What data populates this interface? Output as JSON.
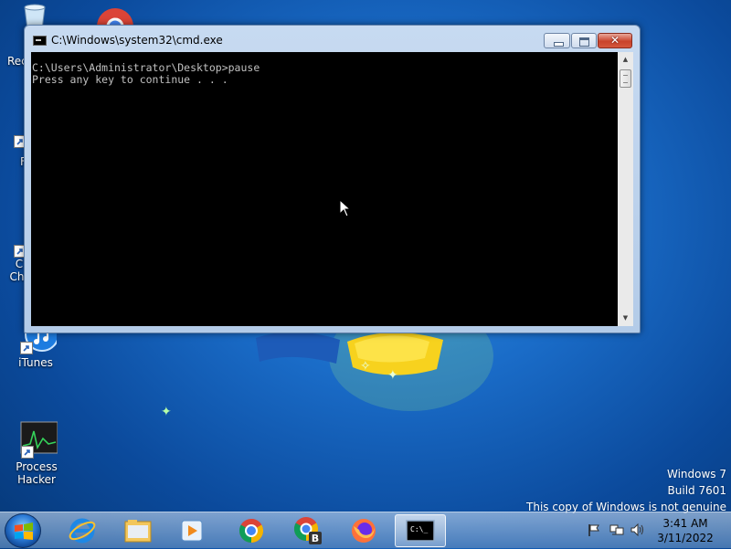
{
  "window": {
    "title": "C:\\Windows\\system32\\cmd.exe",
    "console_lines": "C:\\Users\\Administrator\\Desktop>pause\nPress any key to continue . . .",
    "icon": "console-icon"
  },
  "desktop_icons": [
    {
      "label": "Rec",
      "icon": "recycle-bin-icon"
    },
    {
      "label": "",
      "icon": "chrome-icon"
    },
    {
      "label": "F",
      "icon": "app-shortcut-icon"
    },
    {
      "label": "C\nChr",
      "icon": "chrome-icon"
    },
    {
      "label": "iTunes",
      "icon": "itunes-icon"
    },
    {
      "label": "Process\nHacker",
      "icon": "process-hacker-icon"
    }
  ],
  "watermark": {
    "line1": "Windows 7",
    "line2": "Build 7601",
    "line3": "This copy of Windows is not genuine"
  },
  "taskbar": {
    "items": [
      {
        "icon": "start-orb-icon"
      },
      {
        "icon": "internet-explorer-icon"
      },
      {
        "icon": "file-explorer-icon"
      },
      {
        "icon": "media-player-icon"
      },
      {
        "icon": "chrome-icon"
      },
      {
        "icon": "chrome-b-icon"
      },
      {
        "icon": "firefox-icon"
      },
      {
        "icon": "cmd-icon",
        "active": true
      }
    ],
    "tray_icons": [
      "flag-icon",
      "network-icon",
      "volume-icon"
    ],
    "clock": {
      "time": "3:41 AM",
      "date": "3/11/2022"
    }
  },
  "colors": {
    "console_bg": "#000000",
    "console_text": "#c0c0c0",
    "desktop_blue": "#1a6cc8",
    "close_red": "#c9432b"
  }
}
